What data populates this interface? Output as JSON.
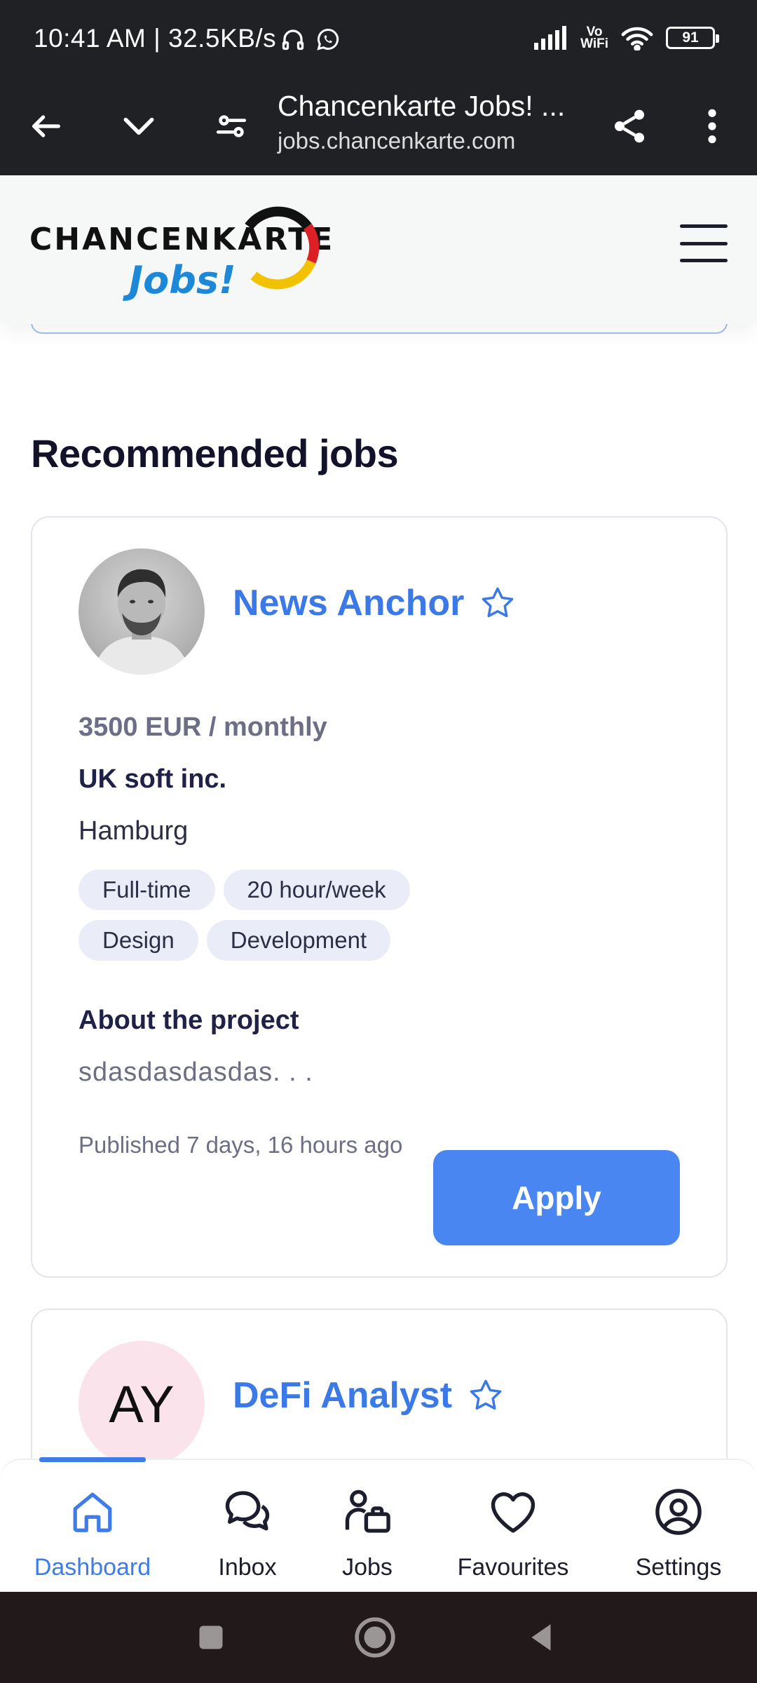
{
  "status_bar": {
    "time_and_speed": "10:41 AM | 32.5KB/s",
    "vowifi_label_top": "Vo",
    "vowifi_label_bottom": "WiFi",
    "battery_level": "91"
  },
  "browser": {
    "page_title": "Chancenkarte Jobs! ...",
    "url": "jobs.chancenkarte.com"
  },
  "site_header": {
    "logo_text_top": "CHANCENKARTE",
    "logo_text_bottom": "Jobs!"
  },
  "main": {
    "section_heading": "Recommended jobs",
    "jobs": [
      {
        "title": "News Anchor",
        "salary": "3500 EUR / monthly",
        "company": "UK soft inc.",
        "location": "Hamburg",
        "tags": [
          "Full-time",
          "20 hour/week",
          "Design",
          "Development"
        ],
        "about_title": "About the project",
        "about_text": "sdasdasdasdas. . .",
        "published": "Published 7 days, 16 hours ago",
        "apply_label": "Apply"
      },
      {
        "title": "DeFi Analyst",
        "avatar_initials": "AY"
      }
    ]
  },
  "bottom_nav": {
    "items": [
      {
        "label": "Dashboard",
        "icon": "home-icon",
        "active": true
      },
      {
        "label": "Inbox",
        "icon": "chat-bubbles-icon",
        "active": false
      },
      {
        "label": "Jobs",
        "icon": "person-briefcase-icon",
        "active": false
      },
      {
        "label": "Favourites",
        "icon": "heart-icon",
        "active": false
      },
      {
        "label": "Settings",
        "icon": "user-circle-icon",
        "active": false
      }
    ]
  },
  "colors": {
    "accent": "#3f7ce8",
    "apply_button": "#4a86f2",
    "job_title": "#3b79e6",
    "tag_background": "#eaedf8",
    "status_bar": "#202124"
  }
}
